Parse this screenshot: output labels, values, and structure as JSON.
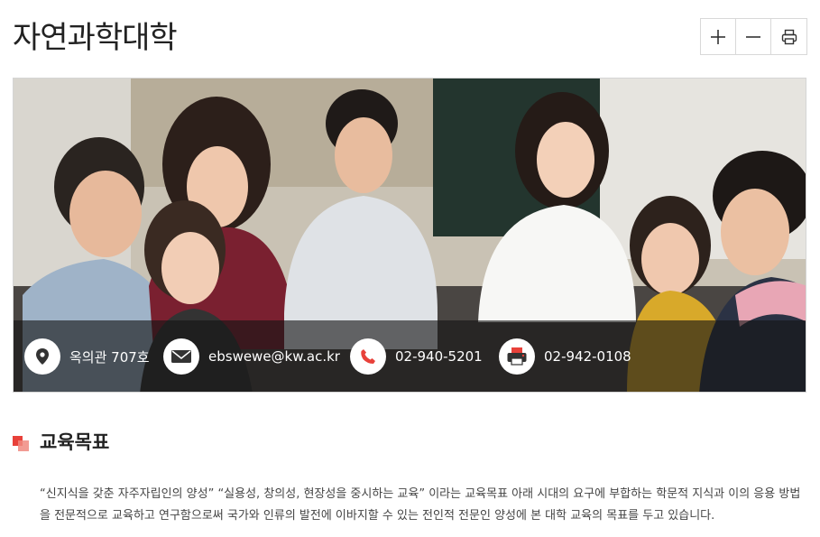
{
  "page": {
    "title": "자연과학대학"
  },
  "tools": {
    "zoom_in": "plus-icon",
    "zoom_out": "minus-icon",
    "print": "printer-icon"
  },
  "hero": {
    "image_alt": "강의실에서 미소 짓는 학생들",
    "contacts": [
      {
        "icon": "location-icon",
        "text": "옥의관 707호"
      },
      {
        "icon": "mail-icon",
        "text": "ebswewe@kw.ac.kr"
      },
      {
        "icon": "phone-icon",
        "text": "02-940-5201"
      },
      {
        "icon": "fax-icon",
        "text": "02-942-0108"
      }
    ]
  },
  "section": {
    "title": "교육목표",
    "description": "“신지식을 갖춘 자주자립인의 양성” “실용성, 창의성, 현장성을 중시하는 교육” 이라는 교육목표 아래 시대의 요구에 부합하는 학문적 지식과 이의 응용 방법을 전문적으로 교육하고 연구함으로써 국가와 인류의 발전에 이바지할 수 있는 전인적 전문인 양성에 본 대학 교육의 목표를 두고 있습니다."
  },
  "colors": {
    "accent": "#e8413a",
    "accent_light": "#f08a80",
    "icon_red": "#e8413a",
    "icon_dark": "#333333"
  }
}
